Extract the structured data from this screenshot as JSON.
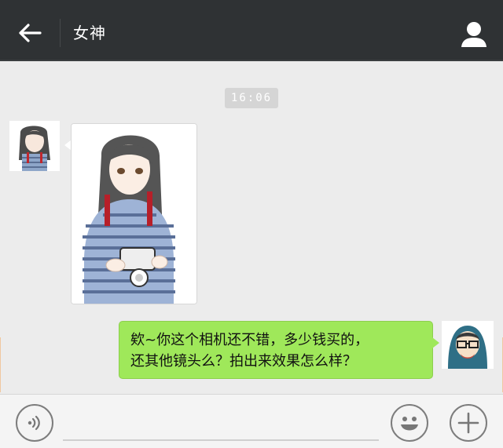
{
  "header": {
    "title": "女神",
    "back_icon": "arrow-left-icon",
    "profile_icon": "person-icon"
  },
  "messages": [
    {
      "type": "timestamp",
      "text": "16:06"
    },
    {
      "type": "image",
      "side": "left",
      "sender_avatar": "girl-avatar",
      "image_desc_icon": "anime-girl-with-camera"
    },
    {
      "type": "text",
      "side": "right",
      "sender_avatar": "hooded-guy-avatar",
      "lines": [
        "欸~你这个相机还不错，多少钱买的，",
        "还其他镜头么？拍出来效果怎么样？"
      ]
    }
  ],
  "inputbar": {
    "voice_icon": "voice-icon",
    "emoji_icon": "emoji-icon",
    "plus_icon": "plus-icon",
    "text_value": ""
  },
  "colors": {
    "header_bg": "#2f3234",
    "chat_bg": "#ececec",
    "sent_bubble": "#9fe85a"
  }
}
